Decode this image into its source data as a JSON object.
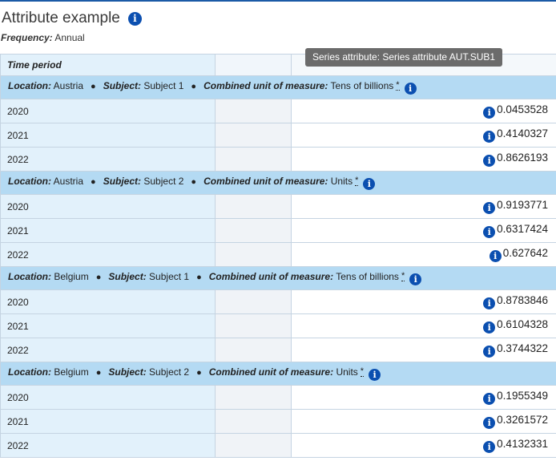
{
  "page": {
    "title": "Attribute example",
    "frequency_label": "Frequency:",
    "frequency_value": "Annual"
  },
  "table": {
    "time_header": "Time period",
    "sections": [
      {
        "location_label": "Location:",
        "location": "Austria",
        "subject_label": "Subject:",
        "subject": "Subject 1",
        "unit_label": "Combined unit of measure:",
        "unit": "Tens of billions",
        "flag": "*",
        "rows": [
          {
            "period": "2020",
            "value": "0.0453528"
          },
          {
            "period": "2021",
            "value": "0.4140327"
          },
          {
            "period": "2022",
            "value": "0.8626193"
          }
        ]
      },
      {
        "location_label": "Location:",
        "location": "Austria",
        "subject_label": "Subject:",
        "subject": "Subject 2",
        "unit_label": "Combined unit of measure:",
        "unit": "Units",
        "flag": "*",
        "rows": [
          {
            "period": "2020",
            "value": "0.9193771"
          },
          {
            "period": "2021",
            "value": "0.6317424"
          },
          {
            "period": "2022",
            "value": "0.627642"
          }
        ]
      },
      {
        "location_label": "Location:",
        "location": "Belgium",
        "subject_label": "Subject:",
        "subject": "Subject 1",
        "unit_label": "Combined unit of measure:",
        "unit": "Tens of billions",
        "flag": "*",
        "rows": [
          {
            "period": "2020",
            "value": "0.8783846"
          },
          {
            "period": "2021",
            "value": "0.6104328"
          },
          {
            "period": "2022",
            "value": "0.3744322"
          }
        ]
      },
      {
        "location_label": "Location:",
        "location": "Belgium",
        "subject_label": "Subject:",
        "subject": "Subject 2",
        "unit_label": "Combined unit of measure:",
        "unit": "Units",
        "flag": "*",
        "rows": [
          {
            "period": "2020",
            "value": "0.1955349"
          },
          {
            "period": "2021",
            "value": "0.3261572"
          },
          {
            "period": "2022",
            "value": "0.4132331"
          }
        ]
      }
    ]
  },
  "tooltip": {
    "text": "Series attribute: Series attribute AUT.SUB1"
  },
  "icons": {
    "info": "info-icon",
    "info_glyph": "i"
  },
  "colors": {
    "accent": "#0b4fb0",
    "section_bg": "#b4daf3",
    "time_bg": "#e2f1fb",
    "tooltip_bg": "#6b6b6b"
  }
}
